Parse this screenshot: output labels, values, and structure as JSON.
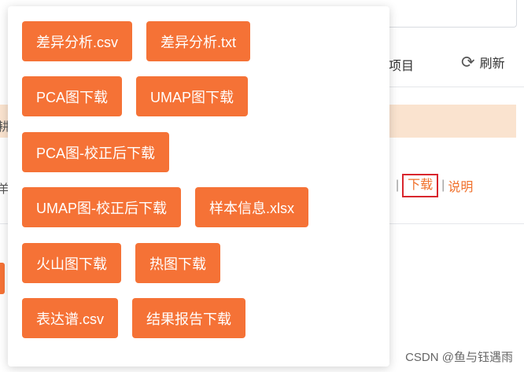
{
  "background": {
    "project_text": "项目",
    "refresh_label": "刷新",
    "left_glyph_1": "耕",
    "left_glyph_2": "羊",
    "links": {
      "download": "下载",
      "explain": "说明"
    }
  },
  "popover": {
    "rows": [
      [
        "差异分析.csv",
        "差异分析.txt"
      ],
      [
        "PCA图下载",
        "UMAP图下载"
      ],
      [
        "PCA图-校正后下载"
      ],
      [
        "UMAP图-校正后下载",
        "样本信息.xlsx"
      ],
      [
        "火山图下载",
        "热图下载"
      ],
      [
        "表达谱.csv",
        "结果报告下载"
      ]
    ]
  },
  "watermark": "CSDN @鱼与钰遇雨",
  "colors": {
    "accent": "#f57236",
    "band": "#fae3cf",
    "highlight_border": "#d9262d",
    "link": "#f0702b"
  }
}
